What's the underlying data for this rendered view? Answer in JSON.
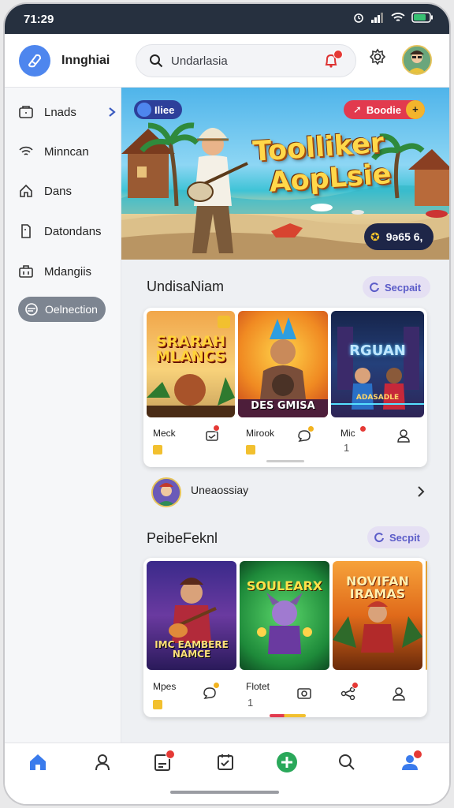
{
  "status": {
    "time": "71:29"
  },
  "header": {
    "app_name": "Innghiai",
    "search_text": "Undarlasia"
  },
  "sidebar": {
    "items": [
      {
        "label": "Lnads"
      },
      {
        "label": "Minncan"
      },
      {
        "label": "Dans"
      },
      {
        "label": "Datondans"
      },
      {
        "label": "Mdangiis"
      },
      {
        "label": "Oelnection"
      }
    ]
  },
  "banner": {
    "tag_left": "Iliee",
    "tag_right": "Boodie",
    "title_line1": "Toolliker",
    "title_line2": "AopLsie",
    "counter": "9ǝ65 6,"
  },
  "section1": {
    "title": "UndisaNiam",
    "see_label": "Secpait",
    "games": [
      {
        "art_title": "SRARAH MLANCS",
        "label": "Meck"
      },
      {
        "art_title": "DES GMISA",
        "label": "Mirook"
      },
      {
        "art_title": "RGUAN",
        "art_subtitle": "ADASADLE",
        "label": "Mic",
        "count": "1"
      }
    ]
  },
  "friend": {
    "name": "Uneaossiay"
  },
  "section2": {
    "title": "PeibeFeknl",
    "see_label": "Secpit",
    "games": [
      {
        "art_title": "IMC EAMBERE NAMCE",
        "label": "Mpes"
      },
      {
        "art_title": "SOULEARX",
        "label": "Flotet",
        "count": "1"
      },
      {
        "art_title": "NOVIFAN IRAMAS",
        "label": ""
      }
    ]
  },
  "colors": {
    "accent": "#4e86ee",
    "statusbar": "#26303f",
    "badge": "#e53935",
    "chip_bg": "#e5e0f3",
    "chip_text": "#5b5cc8"
  }
}
